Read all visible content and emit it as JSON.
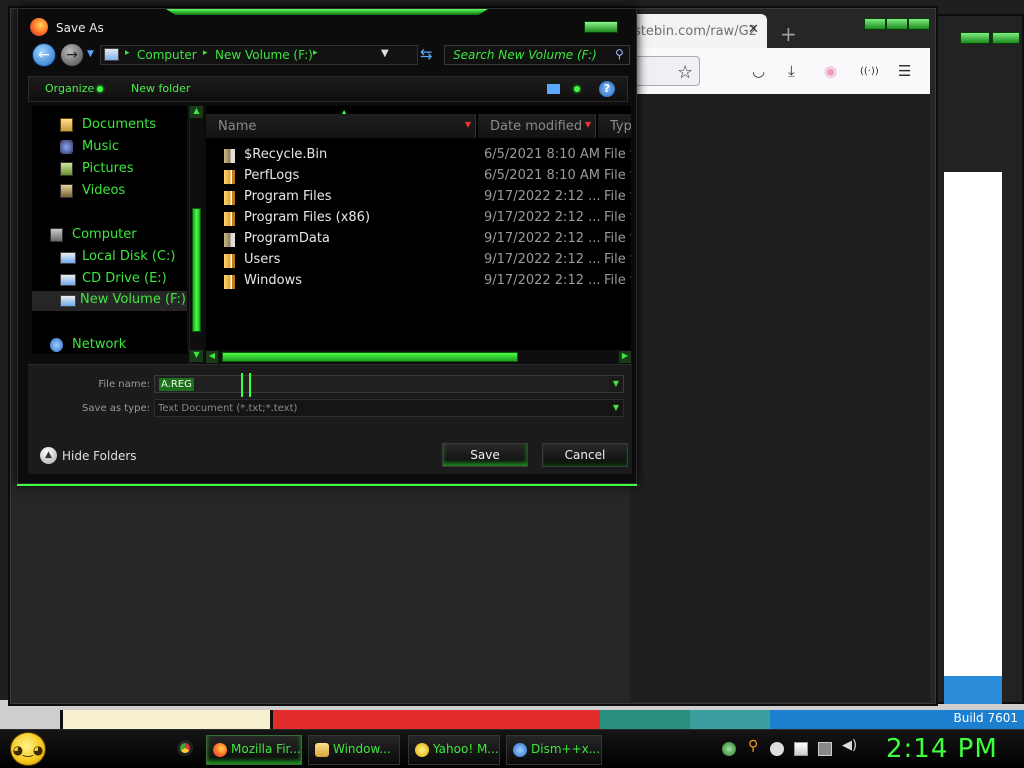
{
  "desktop": {
    "build_label": "Build 7601",
    "build_small": "7"
  },
  "firefox": {
    "tab_title": "stebin.com/raw/G2",
    "tab_close": "✕",
    "new_tab": "+"
  },
  "dialog": {
    "title": "Save As",
    "breadcrumbs": [
      "Computer",
      "New Volume (F:)"
    ],
    "search_placeholder": "Search New Volume (F:)",
    "toolbar": {
      "organize": "Organize",
      "new_folder": "New folder",
      "help": "?"
    },
    "nav": {
      "documents": "Documents",
      "music": "Music",
      "pictures": "Pictures",
      "videos": "Videos",
      "computer": "Computer",
      "local_disk": "Local Disk (C:)",
      "cd_drive": "CD Drive (E:)",
      "new_volume": "New Volume (F:)",
      "network": "Network"
    },
    "columns": {
      "name": "Name",
      "date": "Date modified",
      "type": "Type"
    },
    "files": [
      {
        "name": "$Recycle.Bin",
        "date": "6/5/2021 8:10 AM",
        "type": "File folder"
      },
      {
        "name": "PerfLogs",
        "date": "6/5/2021 8:10 AM",
        "type": "File folder"
      },
      {
        "name": "Program Files",
        "date": "9/17/2022 2:12 ...",
        "type": "File folder"
      },
      {
        "name": "Program Files (x86)",
        "date": "9/17/2022 2:12 ...",
        "type": "File folder"
      },
      {
        "name": "ProgramData",
        "date": "9/17/2022 2:12 ...",
        "type": "File folder"
      },
      {
        "name": "Users",
        "date": "9/17/2022 2:12 ...",
        "type": "File folder"
      },
      {
        "name": "Windows",
        "date": "9/17/2022 2:12 ...",
        "type": "File folder"
      }
    ],
    "file_name_label": "File name:",
    "file_name_value": "A.REG",
    "save_type_label": "Save as type:",
    "save_type_value": "Text Document (*.txt;*.text)",
    "hide_folders": "Hide Folders",
    "save": "Save",
    "cancel": "Cancel"
  },
  "taskbar": {
    "items": [
      {
        "label": "Mozilla Fir...",
        "icon": "firefox-icon"
      },
      {
        "label": "Window...",
        "icon": "folder-icon"
      },
      {
        "label": "Yahoo! M...",
        "icon": "yahoo-icon"
      },
      {
        "label": "Dism++x...",
        "icon": "gear-icon"
      }
    ],
    "clock": "2:14 PM"
  },
  "colors": {
    "accent": "#3ee63e",
    "dialog_bg": "#0c0c0c"
  }
}
